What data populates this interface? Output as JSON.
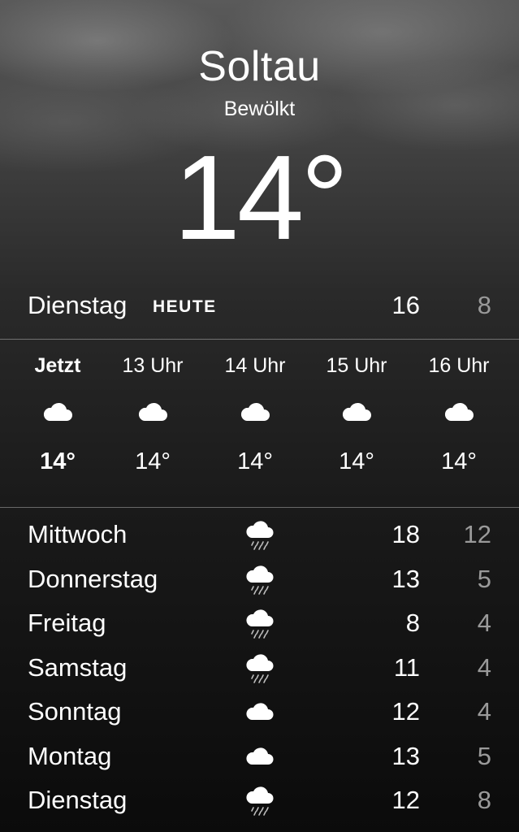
{
  "location": {
    "city": "Soltau",
    "condition": "Bewölkt",
    "temperature": "14°"
  },
  "today": {
    "day": "Dienstag",
    "tag": "HEUTE",
    "high": "16",
    "low": "8"
  },
  "hourly": [
    {
      "label": "Jetzt",
      "icon": "cloud-icon",
      "temp": "14°"
    },
    {
      "label": "13 Uhr",
      "icon": "cloud-icon",
      "temp": "14°"
    },
    {
      "label": "14 Uhr",
      "icon": "cloud-icon",
      "temp": "14°"
    },
    {
      "label": "15 Uhr",
      "icon": "cloud-icon",
      "temp": "14°"
    },
    {
      "label": "16 Uhr",
      "icon": "cloud-icon",
      "temp": "14°"
    }
  ],
  "daily": [
    {
      "day": "Mittwoch",
      "icon": "cloud-rain-icon",
      "high": "18",
      "low": "12"
    },
    {
      "day": "Donnerstag",
      "icon": "cloud-rain-icon",
      "high": "13",
      "low": "5"
    },
    {
      "day": "Freitag",
      "icon": "cloud-rain-icon",
      "high": "8",
      "low": "4"
    },
    {
      "day": "Samstag",
      "icon": "cloud-rain-icon",
      "high": "11",
      "low": "4"
    },
    {
      "day": "Sonntag",
      "icon": "cloud-icon",
      "high": "12",
      "low": "4"
    },
    {
      "day": "Montag",
      "icon": "cloud-icon",
      "high": "13",
      "low": "5"
    },
    {
      "day": "Dienstag",
      "icon": "cloud-rain-icon",
      "high": "12",
      "low": "8"
    }
  ],
  "colors": {
    "text": "#ffffff",
    "muted": "#9a9a9a"
  }
}
